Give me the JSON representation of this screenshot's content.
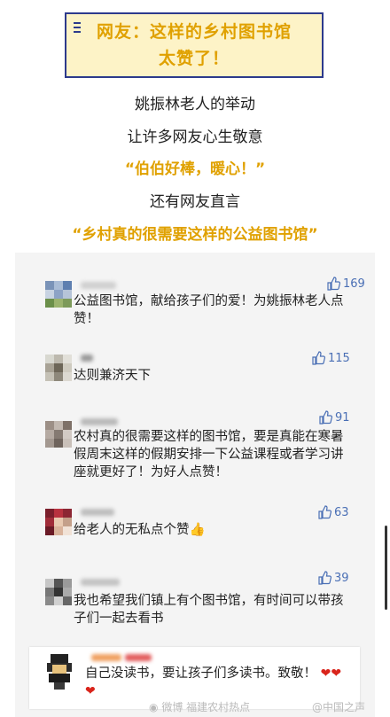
{
  "banner": {
    "line1": "网友：这样的乡村图书馆",
    "line2": "太赞了！"
  },
  "intro": {
    "line1": "姚振林老人的举动",
    "line2": "让许多网友心生敬意",
    "quote1": "“伯伯好棒，暖心！”",
    "line3": "还有网友直言",
    "quote2": "“乡村真的很需要这样的公益图书馆”"
  },
  "comments": [
    {
      "text": "公益图书馆，献给孩子们的爱！为姚振林老人点赞！",
      "likes": "169"
    },
    {
      "text": "达则兼济天下",
      "likes": "115"
    },
    {
      "text": "农村真的很需要这样的图书馆，要是真能在寒暑假周末这样的假期安排一下公益课程或者学习讲座就更好了！为好人点赞！",
      "likes": "91"
    },
    {
      "text": "给老人的无私点个赞👍",
      "likes": "63"
    },
    {
      "text": "我也希望我们镇上有个图书馆，有时间可以带孩子们一起去看书",
      "likes": "39"
    }
  ],
  "featured": {
    "text": "自己没读书，要让孩子们多读书。致敬！"
  },
  "watermarks": {
    "left": "微博 福建农村热点",
    "right": "@中国之声"
  },
  "colors": {
    "gold": "#e0a100",
    "like_blue": "#4a6fb5",
    "heart": "#d9241b"
  },
  "icons": [
    "thumbs-up-icon",
    "heart-icon",
    "weibo-icon"
  ]
}
